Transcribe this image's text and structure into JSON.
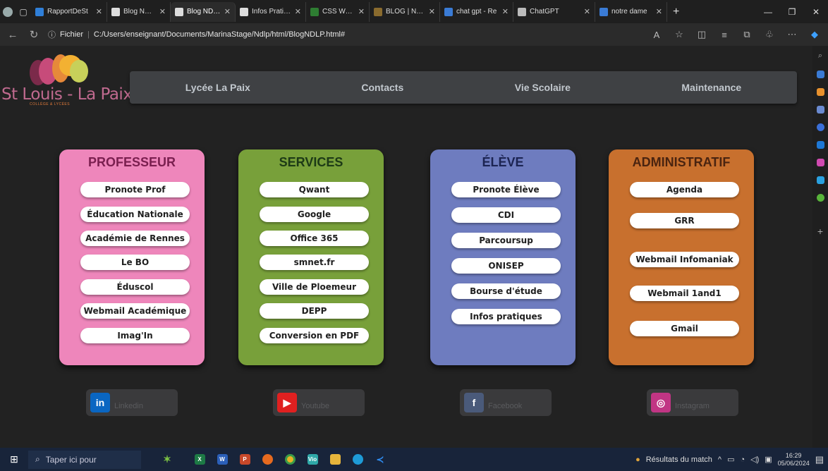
{
  "browser": {
    "tabs": [
      {
        "label": "RapportDeSt",
        "fav": "#2f7fd8"
      },
      {
        "label": "Blog NDLP",
        "fav": "#dddddd"
      },
      {
        "label": "Blog NDLP",
        "fav": "#dddddd",
        "active": true
      },
      {
        "label": "Infos Pratique",
        "fav": "#dddddd"
      },
      {
        "label": "CSS Website",
        "fav": "#2e7d32"
      },
      {
        "label": "BLOG | NDLP",
        "fav": "#8a6b2e"
      },
      {
        "label": "chat gpt - Re",
        "fav": "#3a7bd5"
      },
      {
        "label": "ChatGPT",
        "fav": "#bbbbbb"
      },
      {
        "label": "notre dame",
        "fav": "#3a7bd5"
      }
    ],
    "new_tab": "+",
    "address": {
      "prefix": "Fichier",
      "path": "C:/Users/enseignant/Documents/MarinaStage/Ndlp/html/BlogNDLP.html#"
    }
  },
  "logo": {
    "text": "St Louis - La Paix",
    "subtitle": "COLLÈGE & LYCÉES",
    "colors": [
      "#7b2a4a",
      "#c74b7a",
      "#e6893a",
      "#f3b132",
      "#c7d05a"
    ]
  },
  "nav": {
    "items": [
      "Lycée La Paix",
      "Contacts",
      "Vie Scolaire",
      "Maintenance"
    ]
  },
  "cards": [
    {
      "title": "PROFESSEUR",
      "bg": "#ee86bb",
      "title_color": "#7a1f4f",
      "links": [
        "Pronote Prof",
        "Éducation Nationale",
        "Académie de Rennes",
        "Le BO",
        "Éduscol",
        "Webmail Académique",
        "Imag'In"
      ]
    },
    {
      "title": "SERVICES",
      "bg": "#78a03a",
      "title_color": "#1d3a16",
      "links": [
        "Qwant",
        "Google",
        "Office 365",
        "smnet.fr",
        "Ville de Ploemeur",
        "DEPP",
        "Conversion en PDF"
      ]
    },
    {
      "title": "ÉLÈVE",
      "bg": "#6e7cbf",
      "title_color": "#1c2452",
      "links": [
        "Pronote Élève",
        "CDI",
        "Parcoursup",
        "ONISEP",
        "Bourse d'étude",
        "Infos pratiques"
      ]
    },
    {
      "title": "ADMINISTRATIF",
      "bg": "#c8702e",
      "title_color": "#4a2410",
      "links": [
        "Agenda",
        "GRR",
        "Webmail Infomaniak",
        "Webmail 1and1",
        "Gmail"
      ]
    }
  ],
  "social": [
    {
      "label": "Linkedin",
      "icon": "linkedin-icon",
      "color": "#0a66c2",
      "glyph": "in"
    },
    {
      "label": "Youtube",
      "icon": "youtube-icon",
      "color": "#e02020",
      "glyph": "▶"
    },
    {
      "label": "Facebook",
      "icon": "facebook-icon",
      "color": "#4a5a7a",
      "glyph": "f"
    },
    {
      "label": "Instagram",
      "icon": "instagram-icon",
      "color": "#c13584",
      "glyph": "◎"
    }
  ],
  "taskbar": {
    "search_placeholder": "Taper ici pour",
    "news": "Résultats du match",
    "time": "16:29",
    "date": "05/06/2024"
  }
}
